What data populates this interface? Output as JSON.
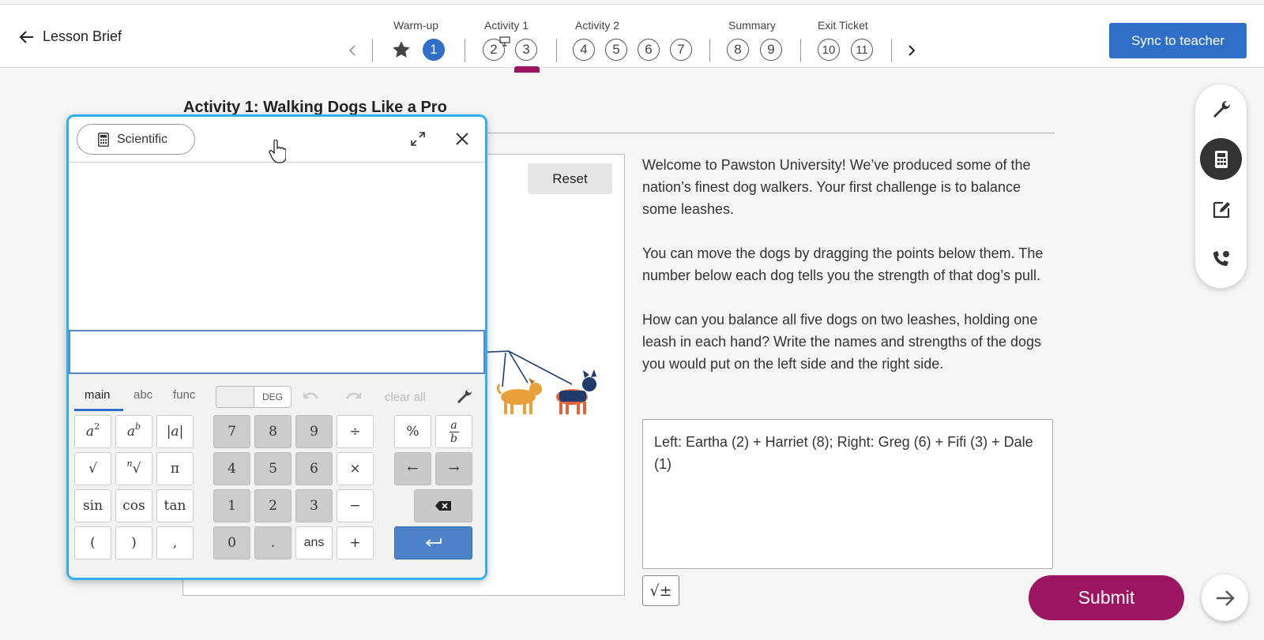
{
  "header": {
    "back_label": "Lesson Brief",
    "sync_label": "Sync to teacher",
    "sections": [
      {
        "label": "Warm-up"
      },
      {
        "label": "Activity 1"
      },
      {
        "label": "Activity 2"
      },
      {
        "label": "Summary"
      },
      {
        "label": "Exit Ticket"
      }
    ],
    "steps": [
      "1",
      "2",
      "3",
      "4",
      "5",
      "6",
      "7",
      "8",
      "9",
      "10",
      "11"
    ],
    "active_step": "1",
    "colors": {
      "brand_blue": "#2f6fc7",
      "active_marker": "#9c1561"
    }
  },
  "activity": {
    "title": "Activity 1: Walking Dogs Like a Pro",
    "reset_label": "Reset",
    "paragraphs": [
      "Welcome to Pawston University! We’ve produced some of the nation’s finest dog walkers. Your first challenge is to balance some leashes.",
      "You can move the dogs by dragging the points below them. The number below each dog tells you the strength of that dog’s pull.",
      "How can you balance all five dogs on two leashes, holding one leash in each hand? Write the names and strengths of the dogs you would put on the left side and the right side."
    ],
    "answer": "Left: Eartha (2) + Harriet (8); Right: Greg (6) + Fifi (3) + Dale (1)",
    "math_button_label": "√±",
    "submit_label": "Submit"
  },
  "tools": [
    {
      "icon": "wrench-icon"
    },
    {
      "icon": "calculator-icon",
      "active": true
    },
    {
      "icon": "edit-note-icon"
    },
    {
      "icon": "phone-hand-icon"
    }
  ],
  "calculator": {
    "mode_label": "Scientific",
    "tabs": [
      "main",
      "abc",
      "func"
    ],
    "active_tab": "main",
    "angle_mode": "DEG",
    "clear_all_label": "clear all",
    "keys": {
      "abs": "|a|",
      "sqrt": "√",
      "pi": "π",
      "sin": "sin",
      "cos": "cos",
      "tan": "tan",
      "lparen": "(",
      "rparen": ")",
      "comma": ",",
      "n7": "7",
      "n8": "8",
      "n9": "9",
      "divide": "÷",
      "n4": "4",
      "n5": "5",
      "n6": "6",
      "times": "×",
      "n1": "1",
      "n2": "2",
      "n3": "3",
      "minus": "−",
      "n0": "0",
      "dot": ".",
      "ans": "ans",
      "plus": "+",
      "percent": "%",
      "left": "←",
      "right": "→"
    },
    "accent": "#2fb0f0"
  }
}
